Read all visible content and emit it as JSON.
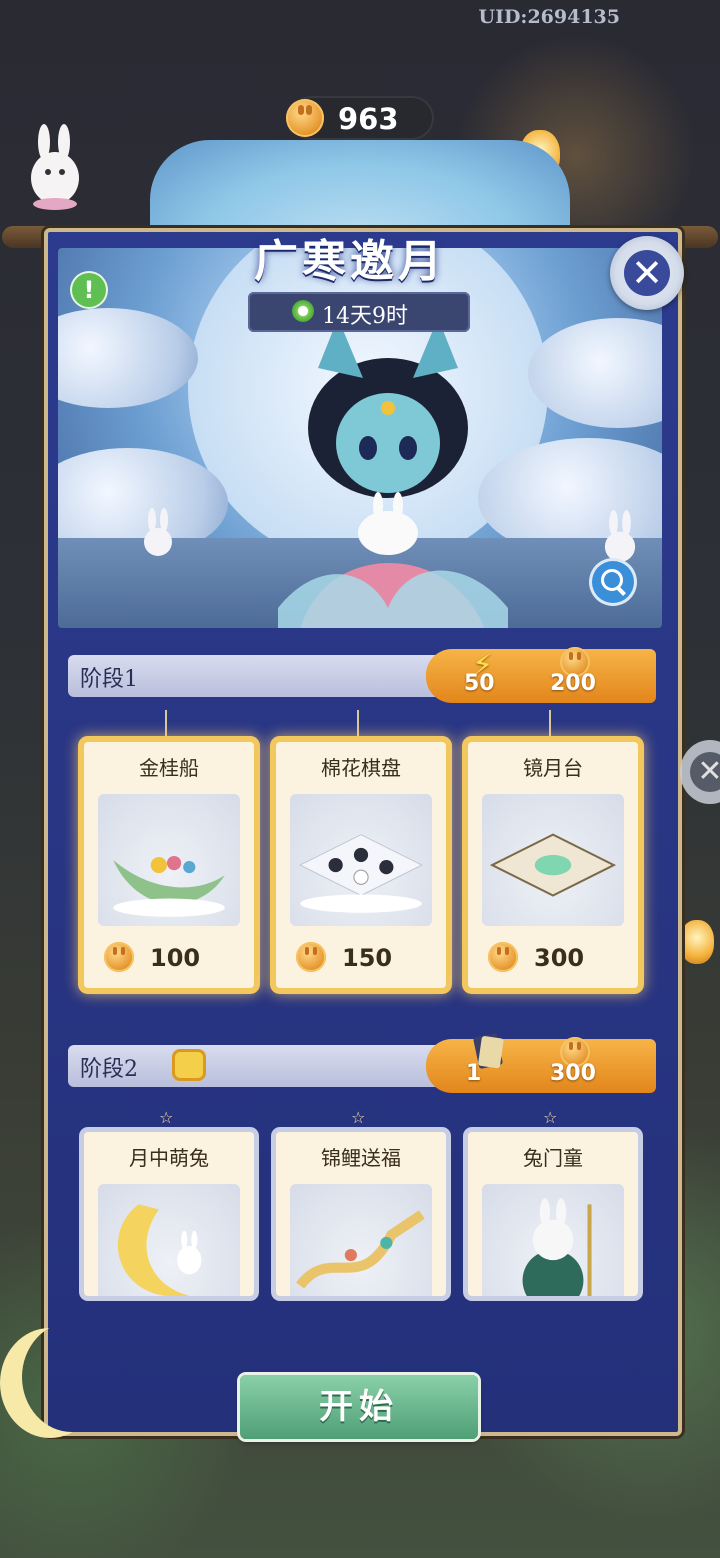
{
  "header": {
    "uid": "UID:2694135",
    "mooncake_count": "963"
  },
  "event": {
    "title": "广寒邀月",
    "timer": "14天9时",
    "alert_mark": "!"
  },
  "controls": {
    "close_symbol": "✕",
    "side_close_symbol": "✕",
    "start_label": "开始"
  },
  "stages": [
    {
      "label": "阶段1",
      "energy_cost": "50",
      "mooncake_cost": "200",
      "items": [
        {
          "name": "金桂船",
          "price": "100"
        },
        {
          "name": "棉花棋盘",
          "price": "150"
        },
        {
          "name": "镜月台",
          "price": "300"
        }
      ]
    },
    {
      "label": "阶段2",
      "ticket_cost": "1",
      "mooncake_cost": "300",
      "items": [
        {
          "name": "月中萌兔"
        },
        {
          "name": "锦鲤送福"
        },
        {
          "name": "兔门童"
        }
      ]
    }
  ],
  "icons": [
    "mooncake-coin-icon",
    "clock-icon",
    "close-icon",
    "magnify-icon",
    "lightning-icon",
    "ticket-icon",
    "lock-badge-icon"
  ],
  "colors": {
    "panel": "#2d3b8e",
    "gold_frame": "#f2c75e",
    "start_button": "#5fae84",
    "cost_tab": "#f0a233"
  }
}
